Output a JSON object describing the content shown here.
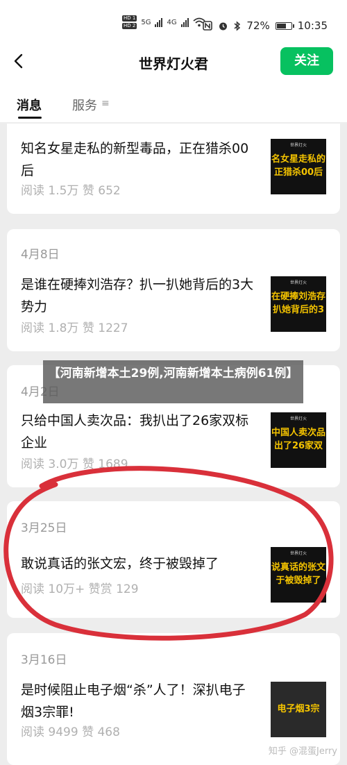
{
  "status": {
    "hd1": "HD 1",
    "hd2": "HD 2",
    "net1": "5G",
    "net2": "4G",
    "battery": "72%",
    "battery_level": 0.72,
    "time": "10:35"
  },
  "nav": {
    "title": "世界灯火君",
    "follow": "关注"
  },
  "tabs": {
    "messages": "消息",
    "services": "服务"
  },
  "articles": [
    {
      "date": "",
      "title": "知名女星走私的新型毒品，正在猎杀00后",
      "meta": "阅读 1.5万  赞 652",
      "thumb_caption": "名女星走私的 正猎杀00后"
    },
    {
      "date": "4月8日",
      "title": "是谁在硬捧刘浩存？扒一扒她背后的3大势力",
      "meta": "阅读 1.8万  赞 1227",
      "thumb_caption": "在硬捧刘浩存 扒她背后的3"
    },
    {
      "date": "4月2日",
      "title": "只给中国人卖次品：我扒出了26家双标企业",
      "meta": "阅读 3.0万  赞 1689",
      "thumb_caption": "中国人卖次品 出了26家双"
    },
    {
      "date": "3月25日",
      "title": "敢说真话的张文宏，终于被毁掉了",
      "meta": "阅读 10万+  赞赏 129",
      "thumb_caption": "说真话的张文 于被毁掉了"
    },
    {
      "date": "3月16日",
      "title": "是时候阻止电子烟“杀”人了！深扒电子烟3宗罪!",
      "meta": "阅读 9499  赞 468",
      "thumb_caption": "电子烟3宗"
    }
  ],
  "thumb_brand": "世界灯火",
  "banner": "【河南新增本土29例,河南新增本土病例61例】",
  "watermark": "知乎 @混蛋Jerry",
  "colors": {
    "accent": "#07c160",
    "annotation": "#d9303a"
  }
}
